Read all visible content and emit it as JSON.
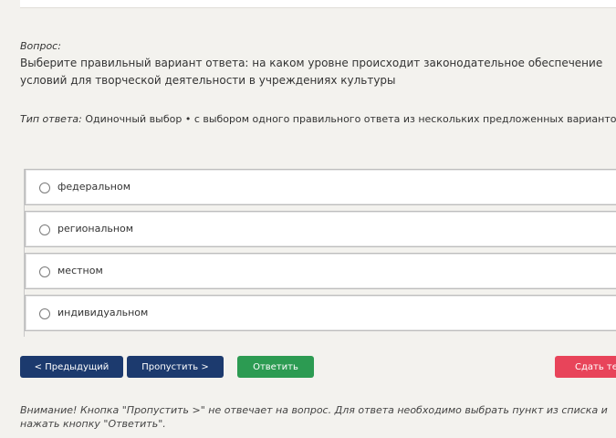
{
  "question": {
    "label": "Вопрос:",
    "text": "Выберите правильный вариант ответа: на каком уровне происходит законодательное обеспечение условий для творческой деятельности в учреждениях культуры"
  },
  "answer_type": {
    "label": "Тип ответа:",
    "value": "Одиночный выбор • с выбором одного правильного ответа из нескольких предложенных вариантов"
  },
  "options": [
    {
      "label": "федеральном"
    },
    {
      "label": "региональном"
    },
    {
      "label": "местном"
    },
    {
      "label": "индивидуальном"
    }
  ],
  "buttons": {
    "prev": "< Предыдущий",
    "skip": "Пропустить >",
    "answer": "Ответить",
    "submit": "Сдать тест"
  },
  "notice": "Внимание! Кнопка \"Пропустить >\" не отвечает на вопрос. Для ответа необходимо выбрать пункт из списка и нажать кнопку \"Ответить\".",
  "colors": {
    "primary": "#1c3a6e",
    "success": "#2c9b52",
    "danger": "#e8445a",
    "background": "#f3f2ee"
  }
}
